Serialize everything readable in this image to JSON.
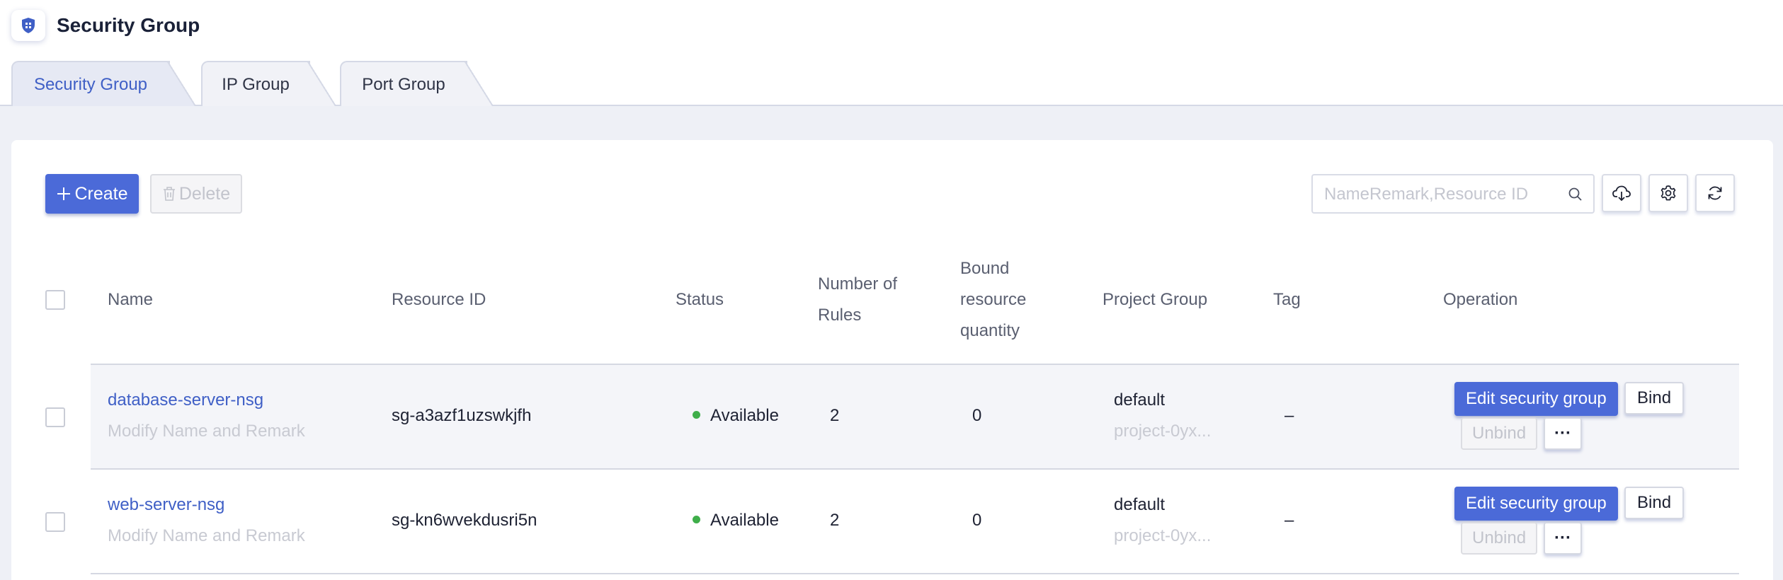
{
  "header": {
    "title": "Security Group"
  },
  "tabs": [
    {
      "label": "Security Group",
      "active": true
    },
    {
      "label": "IP Group",
      "active": false
    },
    {
      "label": "Port Group",
      "active": false
    }
  ],
  "toolbar": {
    "create_label": "Create",
    "delete_label": "Delete",
    "search_placeholder": "NameRemark,Resource ID"
  },
  "table": {
    "columns": {
      "name": "Name",
      "resource_id": "Resource ID",
      "status": "Status",
      "rules_line1": "Number of",
      "rules_line2": "Rules",
      "bound_line1": "Bound",
      "bound_line2": "resource",
      "bound_line3": "quantity",
      "project_group": "Project Group",
      "tag": "Tag",
      "operation": "Operation"
    },
    "rows": [
      {
        "name": "database-server-nsg",
        "remark": "Modify Name and Remark",
        "resource_id": "sg-a3azf1uzswkjfh",
        "status": "Available",
        "rules": "2",
        "bound": "0",
        "project_group": "default",
        "project_id": "project-0yx...",
        "tag": "–",
        "edit_label": "Edit security group",
        "bind_label": "Bind",
        "unbind_label": "Unbind",
        "more_label": "···"
      },
      {
        "name": "web-server-nsg",
        "remark": "Modify Name and Remark",
        "resource_id": "sg-kn6wvekdusri5n",
        "status": "Available",
        "rules": "2",
        "bound": "0",
        "project_group": "default",
        "project_id": "project-0yx...",
        "tag": "–",
        "edit_label": "Edit security group",
        "bind_label": "Bind",
        "unbind_label": "Unbind",
        "more_label": "···"
      }
    ]
  },
  "colors": {
    "accent": "#4b6ad8",
    "link": "#3f5fc6",
    "status_available": "#3fae4a"
  },
  "icons": [
    "shield-icon",
    "plus-icon",
    "trash-icon",
    "search-icon",
    "cloud-download-icon",
    "gear-icon",
    "refresh-icon"
  ]
}
